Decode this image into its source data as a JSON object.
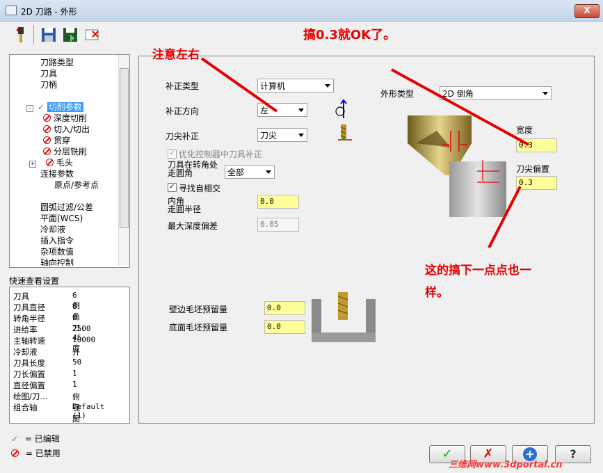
{
  "window": {
    "title": "2D 刀路 - 外形",
    "close": "X"
  },
  "banner": "搞0.3就OK了。",
  "tree": {
    "items": [
      "刀路类型",
      "刀具",
      "刀柄",
      "",
      "切削参数",
      "深度切削",
      "切入/切出",
      "贯穿",
      "分层铣削",
      "毛头",
      "连接参数",
      "原点/参考点",
      "",
      "圆弧过滤/公差",
      "平面(WCS)",
      "冷却液",
      "插入指令",
      "杂项数值",
      "轴向控制"
    ],
    "expander": "+"
  },
  "quick": {
    "title": "快速查看设置",
    "rows": [
      {
        "k": "刀具",
        "v": "6 倒角刀 45度"
      },
      {
        "k": "刀具直径",
        "v": "6"
      },
      {
        "k": "转角半径",
        "v": "0"
      },
      {
        "k": "进给率",
        "v": "2500"
      },
      {
        "k": "主轴转速",
        "v": "10000"
      },
      {
        "k": "冷却液",
        "v": "开"
      },
      {
        "k": "刀具长度",
        "v": "50"
      },
      {
        "k": "刀长偏置",
        "v": "1"
      },
      {
        "k": "直径偏置",
        "v": "1"
      },
      {
        "k": "绘图/刀...",
        "v": "俯视图"
      },
      {
        "k": "组合轴",
        "v": "Default (1)"
      }
    ]
  },
  "legend": {
    "edited": "= 已编辑",
    "disabled": "= 已禁用"
  },
  "form": {
    "comp_type_label": "补正类型",
    "comp_type": "计算机",
    "comp_dir_label": "补正方向",
    "comp_dir": "左",
    "tip_comp_label": "刀尖补正",
    "tip_comp": "刀尖",
    "opt_ctrl": "优化控制器中刀具补正",
    "corner_label_1": "刀具在转角处",
    "corner_label_2": "走圆角",
    "corner": "全部",
    "find_self": "寻找自相交",
    "inner_label_1": "内角",
    "inner_label_2": "走圆半径",
    "inner_val": "0.0",
    "max_dev_label": "最大深度偏差",
    "max_dev": "0.05",
    "contour_type_label": "外形类型",
    "contour_type": "2D 倒角",
    "width_label": "宽度",
    "width_val": "0.3",
    "tip_offset_label": "刀尖偏置",
    "tip_offset_val": "0.3",
    "wall_stock_label": "壁边毛坯预留量",
    "wall_stock": "0.0",
    "floor_stock_label": "底面毛坯预留量",
    "floor_stock": "0.0",
    "check_mark": "✓"
  },
  "annotations": {
    "left_right": "注意左右",
    "same_1": "这的搞下一点点也一",
    "same_2": "样。"
  },
  "buttons": {
    "ok": "✓",
    "cancel": "✗",
    "add": "+",
    "help": "?"
  },
  "watermark": "三维网www.3dportal.cn",
  "colors": {
    "accent_red": "#e60000",
    "input_yellow": "#ffff99",
    "selected_blue": "#3399ff"
  }
}
